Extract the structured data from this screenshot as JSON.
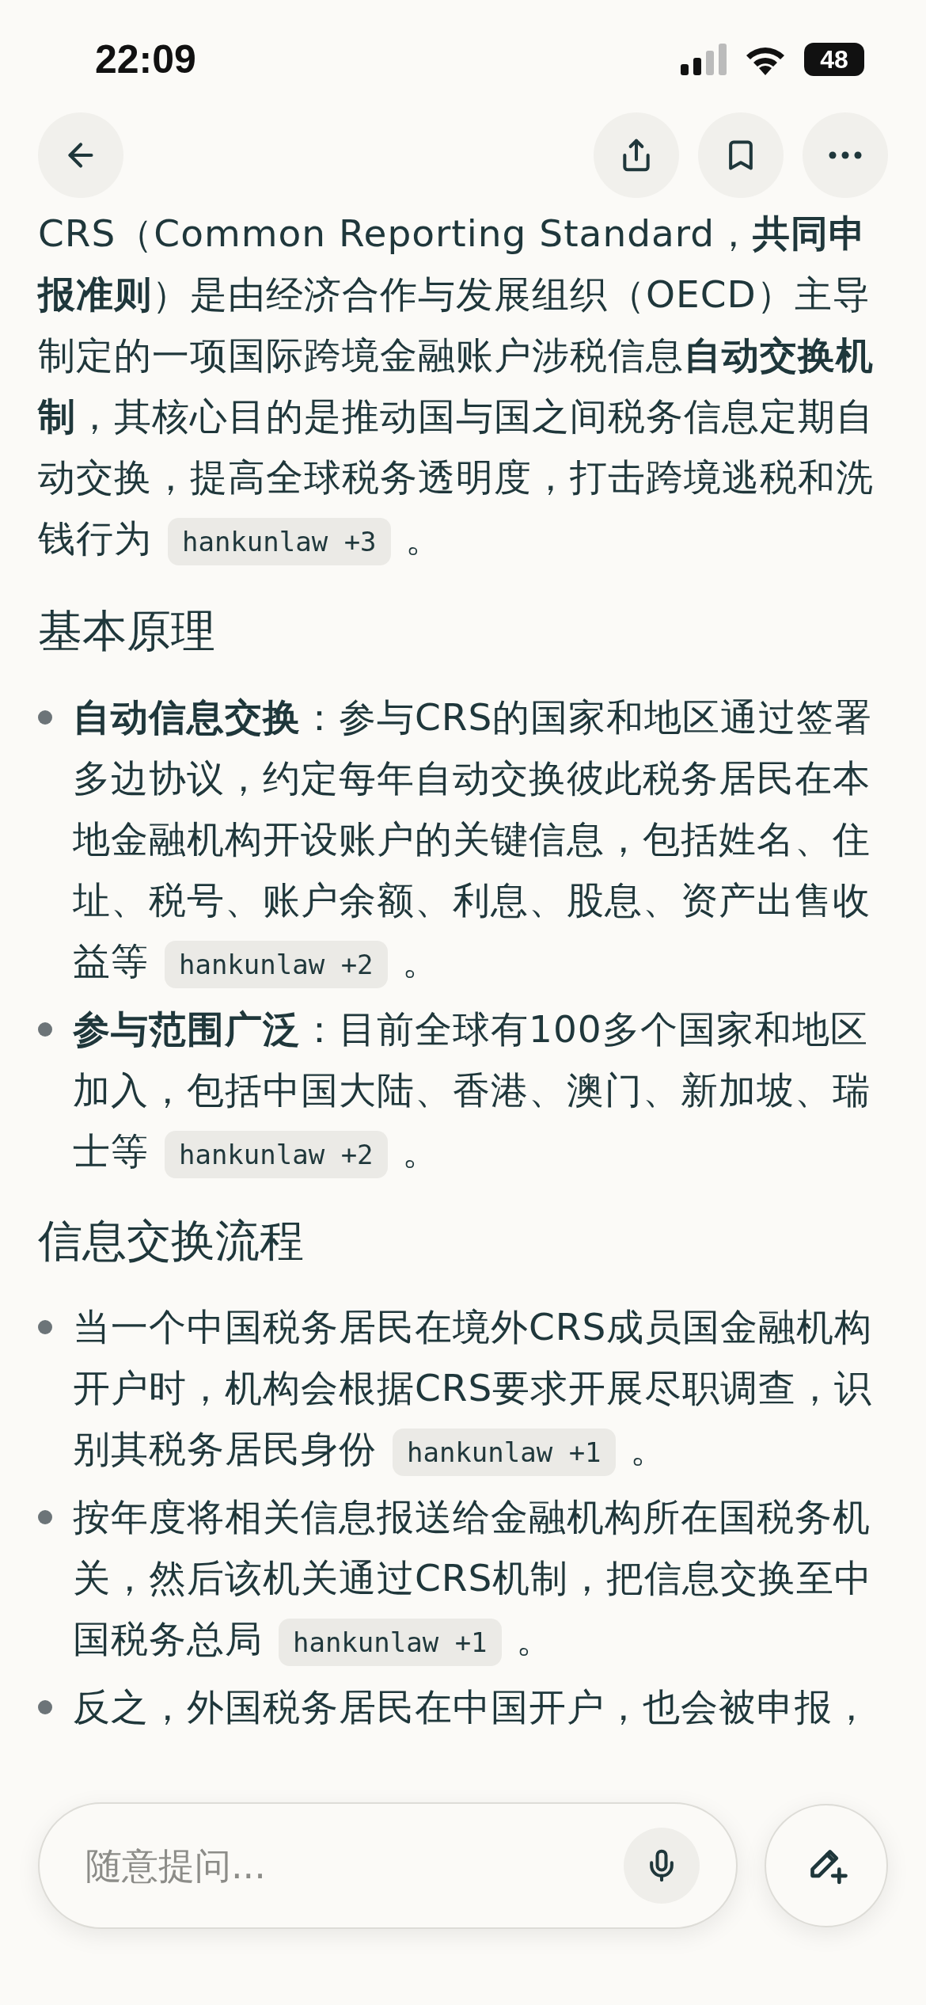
{
  "status_bar": {
    "time": "22:09",
    "battery": "48"
  },
  "content": [
    {
      "kind": "paragraph",
      "text": "CRS（Common Reporting Standard，**共同申报准则**）是由经济合作与发展组织（OECD）主导制定的一项国际跨境金融账户涉税信息**自动交换机制**，其核心目的是推动国与国之间税务信息定期自动交换，提高全球税务透明度，打击跨境逃税和洗钱行为",
      "source": "hankunlaw +3",
      "end": "。"
    },
    {
      "kind": "heading",
      "text": "基本原理"
    },
    {
      "kind": "bullets",
      "items": [
        {
          "text": "**自动信息交换**：参与CRS的国家和地区通过签署多边协议，约定每年自动交换彼此税务居民在本地金融机构开设账户的关键信息，包括姓名、住址、税号、账户余额、利息、股息、资产出售收益等",
          "source": "hankunlaw +2",
          "end": "。"
        },
        {
          "text": "**参与范围广泛**：目前全球有100多个国家和地区加入，包括中国大陆、香港、澳门、新加坡、瑞士等",
          "source": "hankunlaw +2",
          "end": "。"
        }
      ]
    },
    {
      "kind": "heading",
      "text": "信息交换流程"
    },
    {
      "kind": "bullets",
      "items": [
        {
          "text": "当一个中国税务居民在境外CRS成员国金融机构开户时，机构会根据CRS要求开展尽职调查，识别其税务居民身份",
          "source": "hankunlaw +1",
          "end": "。"
        },
        {
          "text": "按年度将相关信息报送给金融机构所在国税务机关，然后该机关通过CRS机制，把信息交换至中国税务总局",
          "source": "hankunlaw +1",
          "end": "。"
        },
        {
          "text": "反之，外国税务居民在中国开户，也会被申报，"
        }
      ]
    }
  ],
  "composer": {
    "placeholder": "随意提问..."
  }
}
